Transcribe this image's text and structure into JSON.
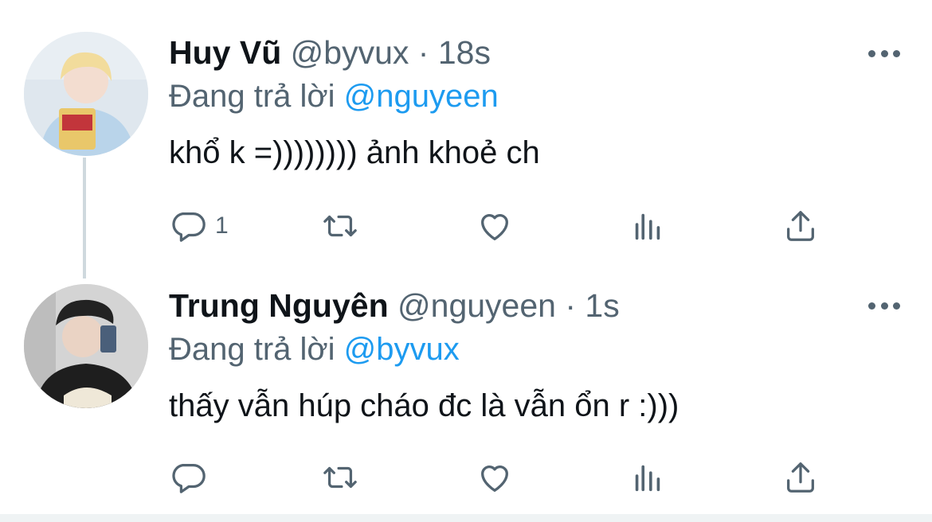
{
  "tweets": [
    {
      "name": "Huy Vũ",
      "handle": "@byvux",
      "separator": "·",
      "time": "18s",
      "replying_prefix": "Đang trả lời",
      "replying_to": "@nguyeen",
      "text": "khổ k =)))))))) ảnh khoẻ ch",
      "reply_count": "1",
      "avatar_icon": "avatar-photo"
    },
    {
      "name": "Trung Nguyên",
      "handle": "@nguyeen",
      "separator": "·",
      "time": "1s",
      "replying_prefix": "Đang trả lời",
      "replying_to": "@byvux",
      "text": "thấy vẫn húp cháo đc là vẫn ổn r :)))",
      "reply_count": "",
      "avatar_icon": "avatar-photo"
    }
  ],
  "icons": {
    "reply": "reply-icon",
    "retweet": "retweet-icon",
    "like": "like-icon",
    "views": "views-icon",
    "share": "share-icon",
    "more": "more-icon"
  },
  "colors": {
    "text": "#0f1419",
    "secondary": "#536471",
    "accent": "#1d9bf0",
    "thread_line": "#cfd9de"
  }
}
